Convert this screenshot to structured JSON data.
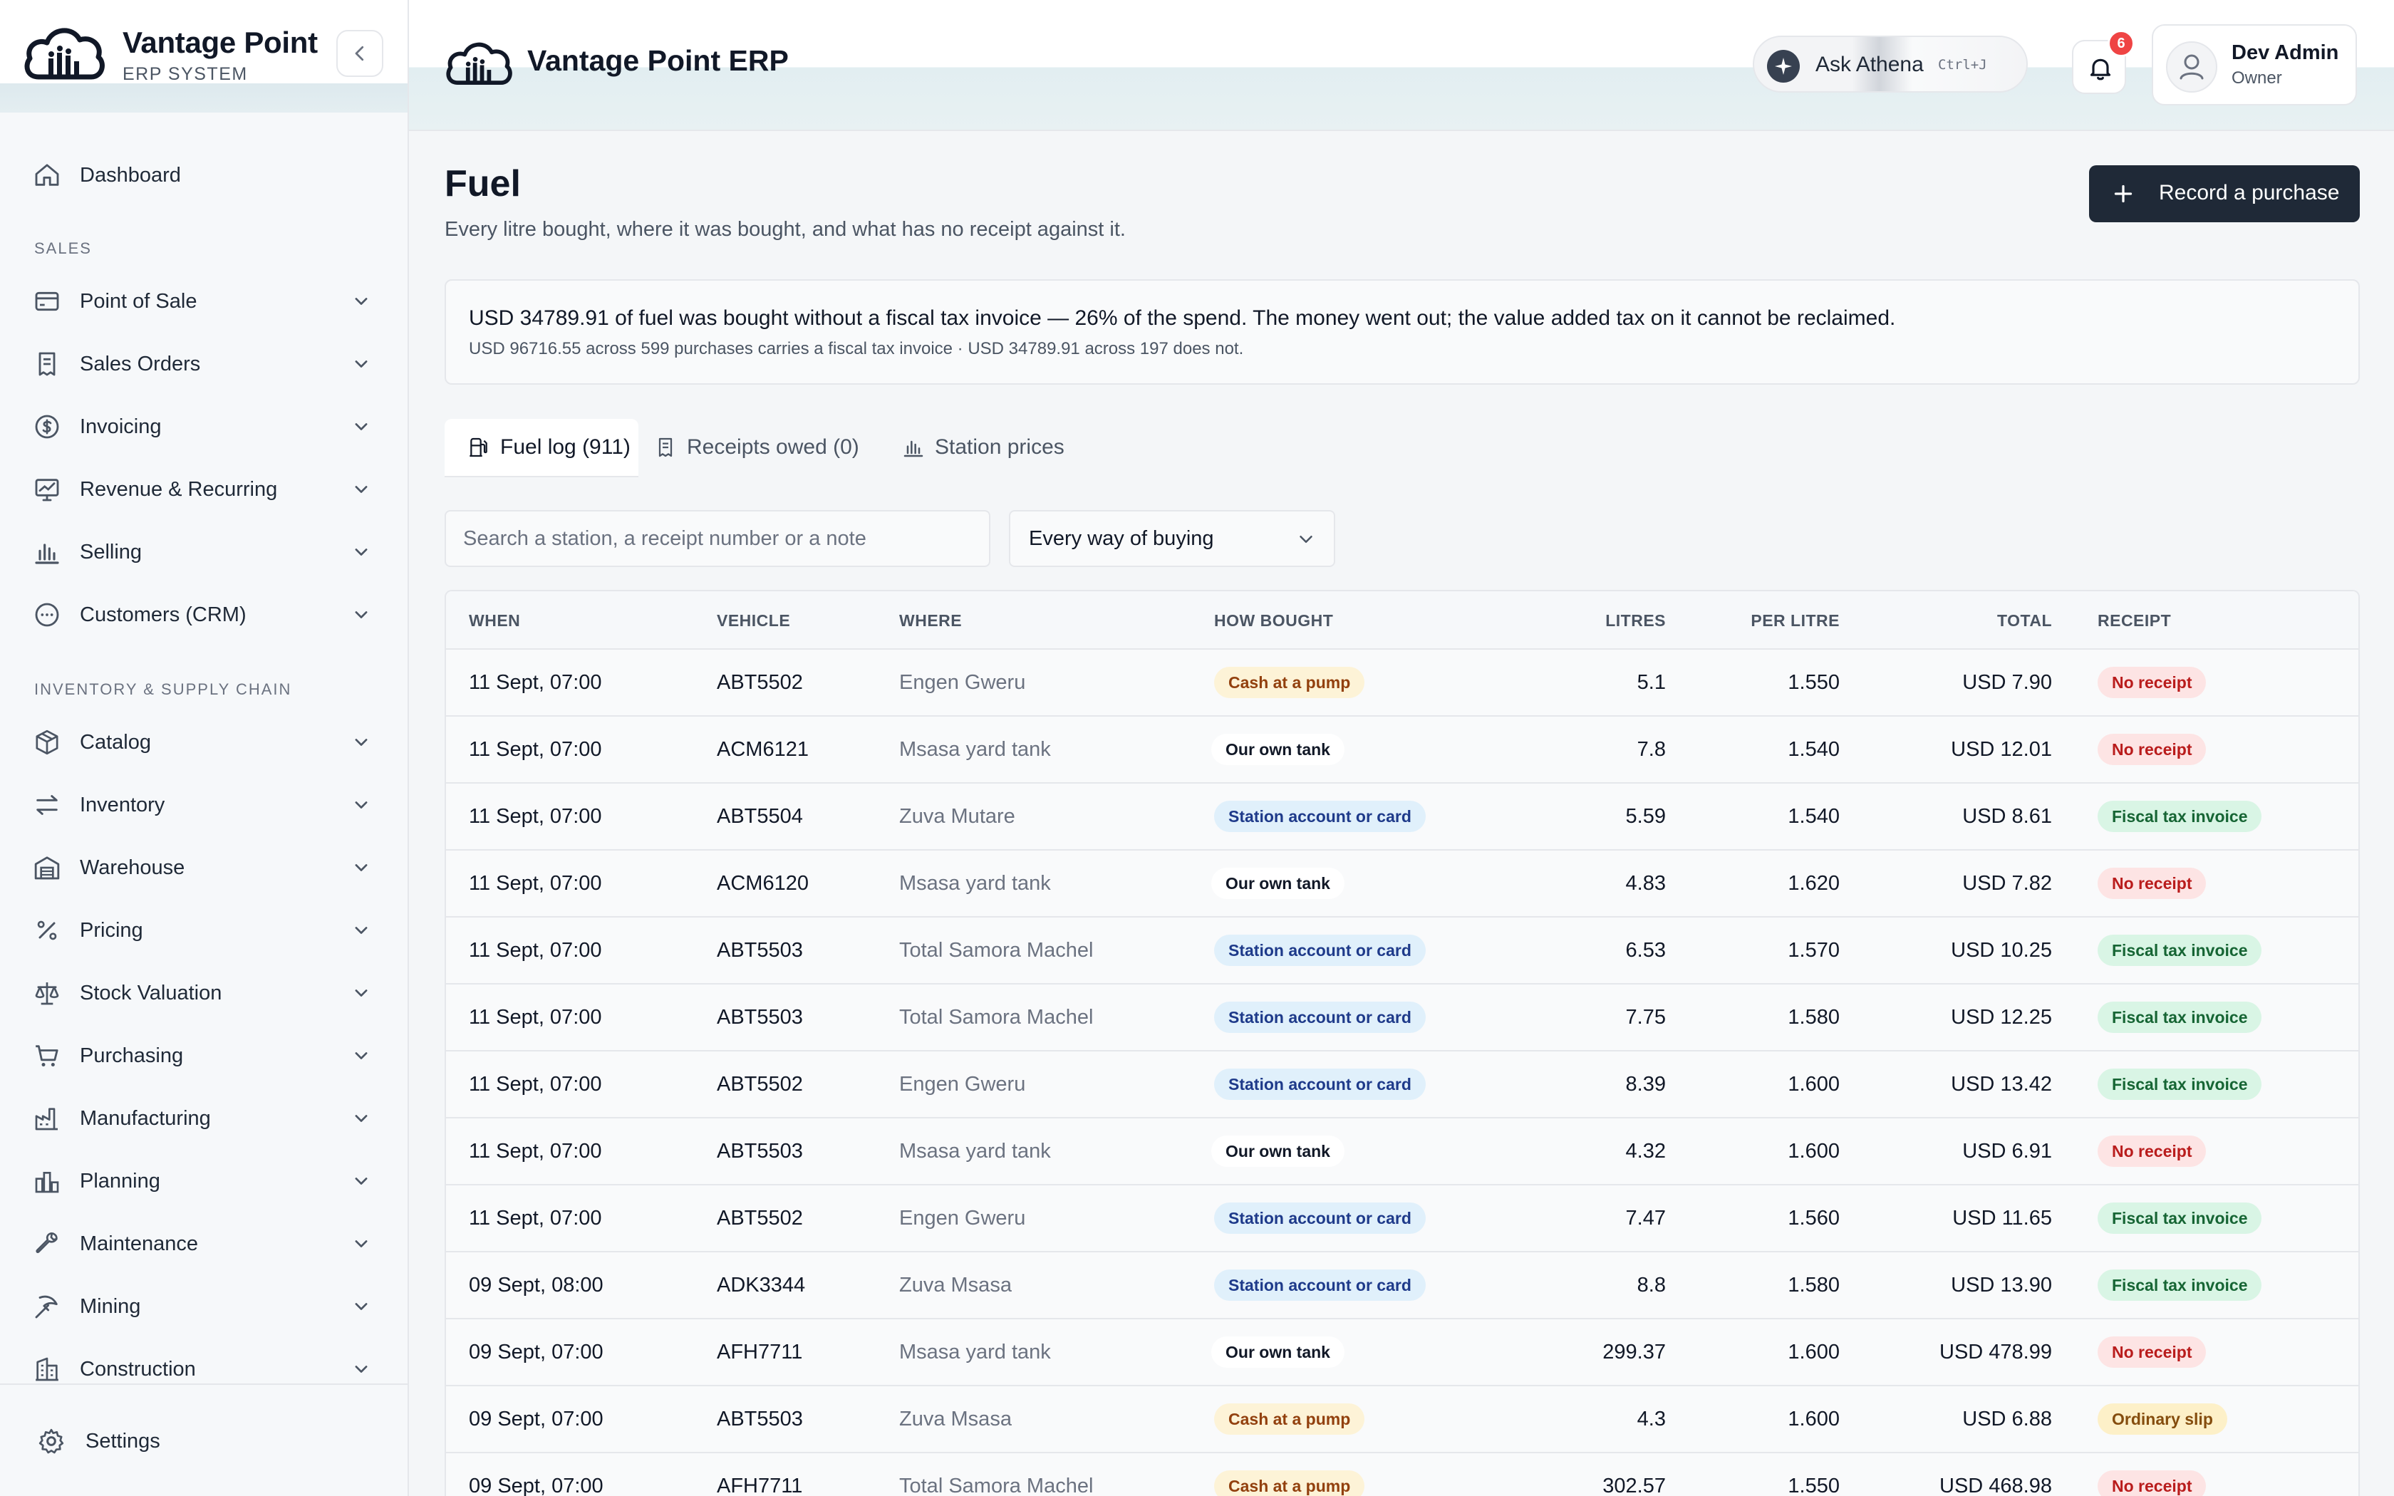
{
  "brand": {
    "name": "Vantage Point",
    "subtitle": "ERP SYSTEM"
  },
  "header": {
    "title": "Vantage Point ERP",
    "ask_label": "Ask Athena",
    "ask_shortcut": "Ctrl+J",
    "notification_count": "6",
    "user_name": "Dev Admin",
    "user_role": "Owner"
  },
  "sidebar": {
    "top_item": {
      "label": "Dashboard",
      "icon": "home-icon"
    },
    "sections": [
      {
        "label": "SALES",
        "items": [
          {
            "label": "Point of Sale",
            "icon": "card-icon"
          },
          {
            "label": "Sales Orders",
            "icon": "receipt-icon"
          },
          {
            "label": "Invoicing",
            "icon": "dollar-icon"
          },
          {
            "label": "Revenue & Recurring",
            "icon": "trend-chart-icon"
          },
          {
            "label": "Selling",
            "icon": "bar-chart-icon"
          },
          {
            "label": "Customers (CRM)",
            "icon": "chat-icon"
          }
        ]
      },
      {
        "label": "INVENTORY & SUPPLY CHAIN",
        "items": [
          {
            "label": "Catalog",
            "icon": "box-icon"
          },
          {
            "label": "Inventory",
            "icon": "transfer-icon"
          },
          {
            "label": "Warehouse",
            "icon": "warehouse-icon"
          },
          {
            "label": "Pricing",
            "icon": "percent-icon"
          },
          {
            "label": "Stock Valuation",
            "icon": "scale-icon"
          },
          {
            "label": "Purchasing",
            "icon": "cart-icon"
          },
          {
            "label": "Manufacturing",
            "icon": "factory-icon"
          },
          {
            "label": "Planning",
            "icon": "planning-icon"
          },
          {
            "label": "Maintenance",
            "icon": "wrench-icon"
          },
          {
            "label": "Mining",
            "icon": "pickaxe-icon"
          },
          {
            "label": "Construction",
            "icon": "building-icon"
          }
        ]
      }
    ],
    "footer_label": "Settings"
  },
  "page": {
    "title": "Fuel",
    "subtitle": "Every litre bought, where it was bought, and what has no receipt against it.",
    "record_button": "Record a purchase"
  },
  "alert": {
    "line1": "USD 34789.91 of fuel was bought without a fiscal tax invoice — 26% of the spend. The money went out; the value added tax on it cannot be reclaimed.",
    "line2": "USD 96716.55 across 599 purchases carries a fiscal tax invoice · USD 34789.91 across 197 does not."
  },
  "tabs": [
    {
      "label": "Fuel log (911)",
      "icon": "fuel-icon",
      "active": true
    },
    {
      "label": "Receipts owed (0)",
      "icon": "receipt-icon",
      "active": false
    },
    {
      "label": "Station prices",
      "icon": "bar-chart-icon",
      "active": false
    }
  ],
  "filters": {
    "search_placeholder": "Search a station, a receipt number or a note",
    "method_value": "Every way of buying"
  },
  "table": {
    "columns": [
      "WHEN",
      "VEHICLE",
      "WHERE",
      "HOW BOUGHT",
      "LITRES",
      "PER LITRE",
      "TOTAL",
      "RECEIPT"
    ],
    "rows": [
      {
        "when": "11 Sept, 07:00",
        "vehicle": "ABT5502",
        "where": "Engen Gweru",
        "how": "Cash at a pump",
        "litres": "5.1",
        "per_litre": "1.550",
        "total": "USD 7.90",
        "receipt": "No receipt"
      },
      {
        "when": "11 Sept, 07:00",
        "vehicle": "ACM6121",
        "where": "Msasa yard tank",
        "how": "Our own tank",
        "litres": "7.8",
        "per_litre": "1.540",
        "total": "USD 12.01",
        "receipt": "No receipt"
      },
      {
        "when": "11 Sept, 07:00",
        "vehicle": "ABT5504",
        "where": "Zuva Mutare",
        "how": "Station account or card",
        "litres": "5.59",
        "per_litre": "1.540",
        "total": "USD 8.61",
        "receipt": "Fiscal tax invoice"
      },
      {
        "when": "11 Sept, 07:00",
        "vehicle": "ACM6120",
        "where": "Msasa yard tank",
        "how": "Our own tank",
        "litres": "4.83",
        "per_litre": "1.620",
        "total": "USD 7.82",
        "receipt": "No receipt"
      },
      {
        "when": "11 Sept, 07:00",
        "vehicle": "ABT5503",
        "where": "Total Samora Machel",
        "how": "Station account or card",
        "litres": "6.53",
        "per_litre": "1.570",
        "total": "USD 10.25",
        "receipt": "Fiscal tax invoice"
      },
      {
        "when": "11 Sept, 07:00",
        "vehicle": "ABT5503",
        "where": "Total Samora Machel",
        "how": "Station account or card",
        "litres": "7.75",
        "per_litre": "1.580",
        "total": "USD 12.25",
        "receipt": "Fiscal tax invoice"
      },
      {
        "when": "11 Sept, 07:00",
        "vehicle": "ABT5502",
        "where": "Engen Gweru",
        "how": "Station account or card",
        "litres": "8.39",
        "per_litre": "1.600",
        "total": "USD 13.42",
        "receipt": "Fiscal tax invoice"
      },
      {
        "when": "11 Sept, 07:00",
        "vehicle": "ABT5503",
        "where": "Msasa yard tank",
        "how": "Our own tank",
        "litres": "4.32",
        "per_litre": "1.600",
        "total": "USD 6.91",
        "receipt": "No receipt"
      },
      {
        "when": "11 Sept, 07:00",
        "vehicle": "ABT5502",
        "where": "Engen Gweru",
        "how": "Station account or card",
        "litres": "7.47",
        "per_litre": "1.560",
        "total": "USD 11.65",
        "receipt": "Fiscal tax invoice"
      },
      {
        "when": "09 Sept, 08:00",
        "vehicle": "ADK3344",
        "where": "Zuva Msasa",
        "how": "Station account or card",
        "litres": "8.8",
        "per_litre": "1.580",
        "total": "USD 13.90",
        "receipt": "Fiscal tax invoice"
      },
      {
        "when": "09 Sept, 07:00",
        "vehicle": "AFH7711",
        "where": "Msasa yard tank",
        "how": "Our own tank",
        "litres": "299.37",
        "per_litre": "1.600",
        "total": "USD 478.99",
        "receipt": "No receipt"
      },
      {
        "when": "09 Sept, 07:00",
        "vehicle": "ABT5503",
        "where": "Zuva Msasa",
        "how": "Cash at a pump",
        "litres": "4.3",
        "per_litre": "1.600",
        "total": "USD 6.88",
        "receipt": "Ordinary slip"
      },
      {
        "when": "09 Sept, 07:00",
        "vehicle": "AFH7711",
        "where": "Total Samora Machel",
        "how": "Cash at a pump",
        "litres": "302.57",
        "per_litre": "1.550",
        "total": "USD 468.98",
        "receipt": "No receipt"
      }
    ]
  },
  "pill_styles": {
    "Cash at a pump": {
      "bg": "#fdf3d7",
      "fg": "#92400e"
    },
    "Our own tank": {
      "bg": "#ffffff",
      "fg": "#111827"
    },
    "Station account or card": {
      "bg": "#e0f0fb",
      "fg": "#1e3a8a"
    },
    "No receipt": {
      "bg": "#fde4e4",
      "fg": "#b91c1c"
    },
    "Fiscal tax invoice": {
      "bg": "#d9f5e5",
      "fg": "#166534"
    },
    "Ordinary slip": {
      "bg": "#fdf0c8",
      "fg": "#854d0e"
    }
  }
}
